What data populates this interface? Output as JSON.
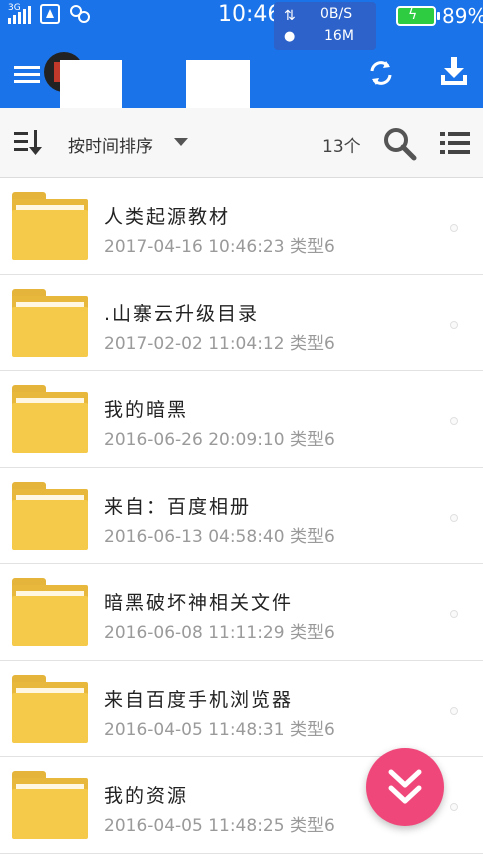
{
  "status_bar": {
    "network": "3G",
    "time": "10:46",
    "upload_speed": "0B/S",
    "download_total": "16M",
    "battery_percent": "89%"
  },
  "toolbar": {
    "menu_icon": "hamburger-menu-icon",
    "sync_icon": "sync-icon",
    "download_icon": "download-icon"
  },
  "sortbar": {
    "sort_label": "按时间排序",
    "count": "13个"
  },
  "files": [
    {
      "name": "人类起源教材",
      "date": "2017-04-16 10:46:23",
      "type": "类型6"
    },
    {
      "name": ".山寨云升级目录",
      "date": "2017-02-02 11:04:12",
      "type": "类型6"
    },
    {
      "name": "我的暗黑",
      "date": "2016-06-26 20:09:10",
      "type": "类型6"
    },
    {
      "name": "来自：百度相册",
      "date": "2016-06-13 04:58:40",
      "type": "类型6"
    },
    {
      "name": "暗黑破坏神相关文件",
      "date": "2016-06-08 11:11:29",
      "type": "类型6"
    },
    {
      "name": "来自百度手机浏览器",
      "date": "2016-04-05 11:48:31",
      "type": "类型6"
    },
    {
      "name": "我的资源",
      "date": "2016-04-05 11:48:25",
      "type": "类型6"
    }
  ],
  "colors": {
    "primary": "#1a73e8",
    "folder": "#f5c94a",
    "fab": "#f0477a"
  }
}
